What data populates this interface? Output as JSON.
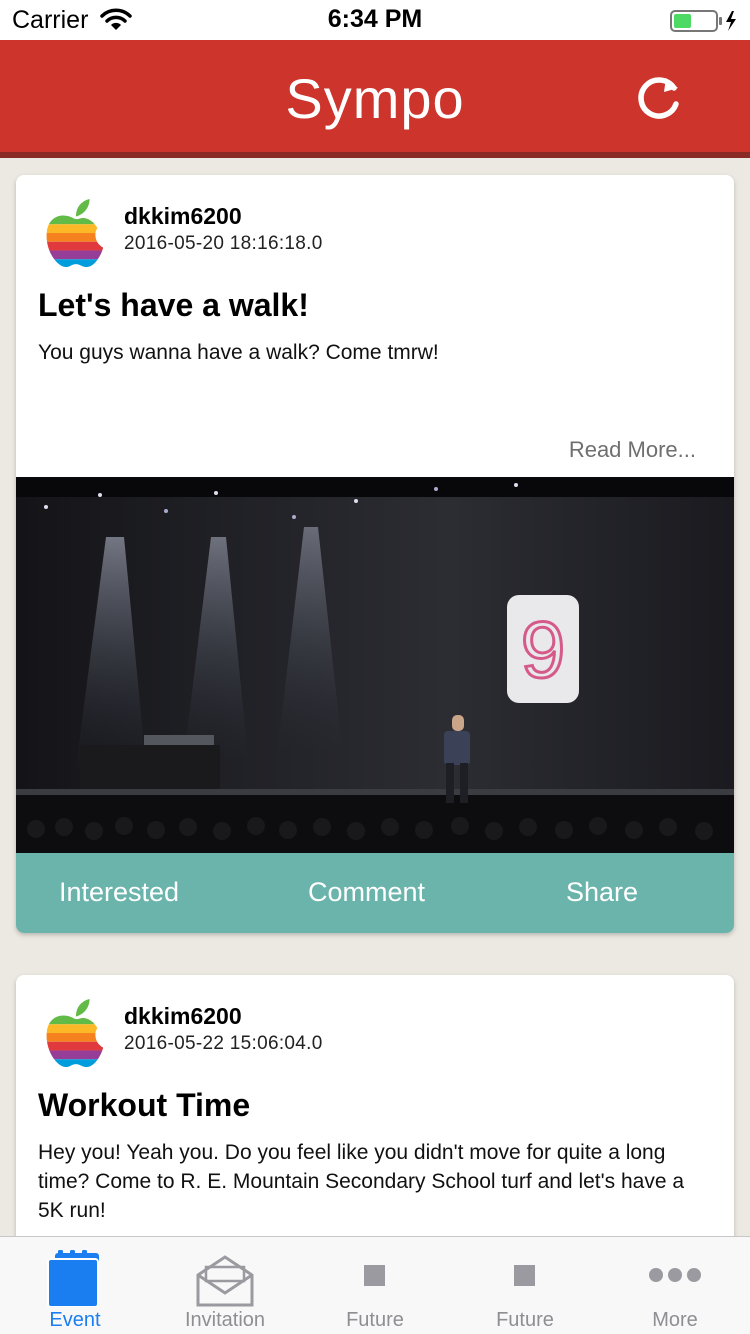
{
  "status_bar": {
    "carrier": "Carrier",
    "time": "6:34 PM"
  },
  "header": {
    "title": "Sympo",
    "refresh_icon": "refresh-icon",
    "color": "#cd342b"
  },
  "posts": [
    {
      "author": "dkkim6200",
      "timestamp": "2016-05-20 18:16:18.0",
      "title": "Let's have a walk!",
      "body": "You guys wanna have a walk? Come tmrw!",
      "read_more": "Read More...",
      "image_text": "9",
      "actions": {
        "interested": "Interested",
        "comment": "Comment",
        "share": "Share"
      }
    },
    {
      "author": "dkkim6200",
      "timestamp": "2016-05-22 15:06:04.0",
      "title": "Workout Time",
      "body": "Hey you! Yeah you. Do you feel like you didn't move for quite a long time? Come to R. E. Mountain Secondary School turf and let's have a 5K run!"
    }
  ],
  "tabs": [
    {
      "label": "Event",
      "icon": "calendar-icon",
      "active": true
    },
    {
      "label": "Invitation",
      "icon": "envelope-icon",
      "active": false
    },
    {
      "label": "Future",
      "icon": "square-icon",
      "active": false
    },
    {
      "label": "Future",
      "icon": "square-icon",
      "active": false
    },
    {
      "label": "More",
      "icon": "more-dots-icon",
      "active": false
    }
  ],
  "colors": {
    "accent": "#cd342b",
    "action_bar": "#6ab4ac",
    "tab_active": "#1b7ef0",
    "tab_inactive": "#8e8e93"
  }
}
